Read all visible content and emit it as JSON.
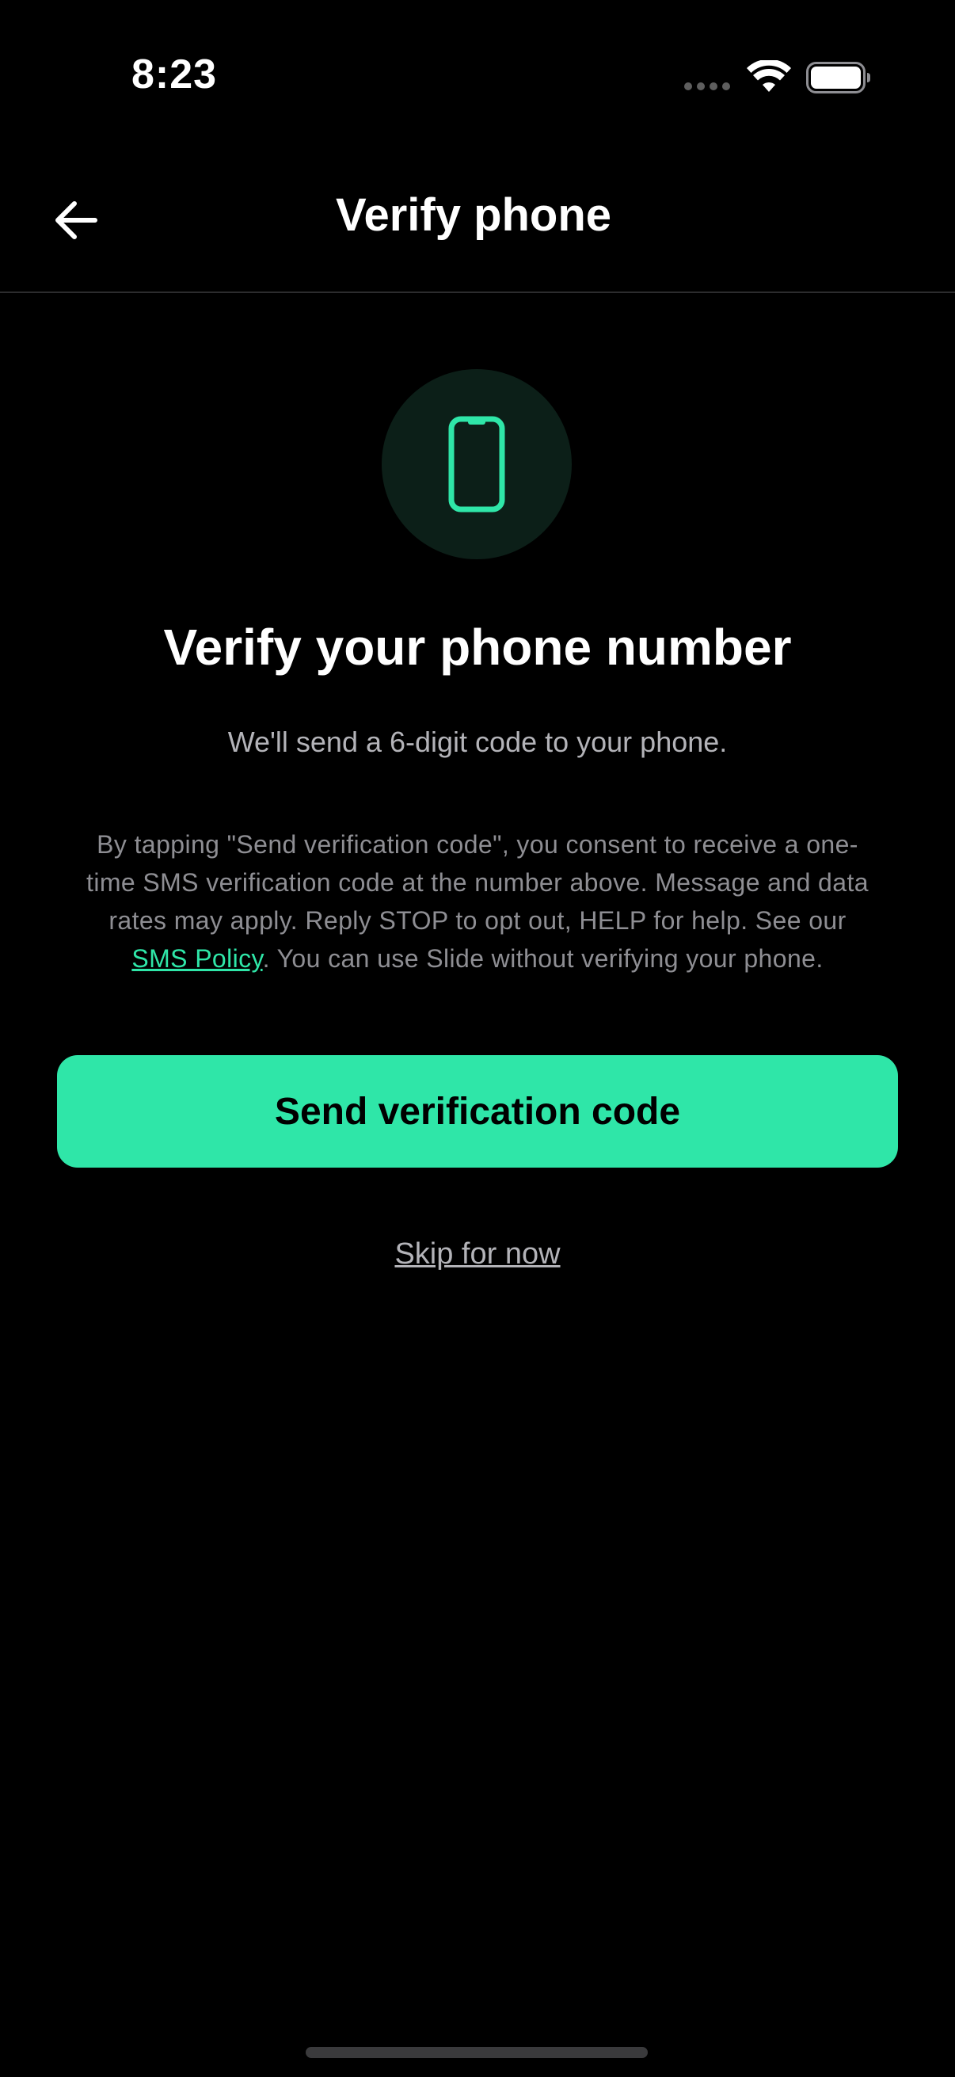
{
  "status_bar": {
    "time": "8:23"
  },
  "nav": {
    "title": "Verify phone",
    "back_icon": "arrow-left-icon"
  },
  "main": {
    "icon": "smartphone-icon",
    "heading": "Verify your phone number",
    "subheading": "We'll send a 6-digit code to your phone.",
    "consent": {
      "text_before_link": "By tapping \"Send verification code\", you consent to receive a one-time SMS verification code at the number above. Message and data rates may apply. Reply STOP to opt out, HELP for help. See our ",
      "link_label": "SMS Policy",
      "text_after_link": ". You can use Slide without verifying your phone."
    },
    "send_button_label": "Send verification code",
    "skip_label": "Skip for now"
  },
  "colors": {
    "accent": "#2fe6a8",
    "background": "#000000",
    "icon_circle": "#0c1f18"
  }
}
